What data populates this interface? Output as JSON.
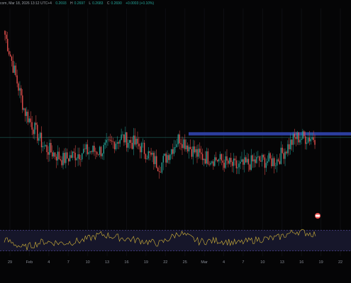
{
  "header": {
    "symbol_suffix": "com, Mar 18, 2026 13:12 UTC+4",
    "ohlc": [
      {
        "label": "",
        "value": "0.2693"
      },
      {
        "label": "H",
        "value": "0.2697"
      },
      {
        "label": "L",
        "value": "0.2683"
      },
      {
        "label": "C",
        "value": "0.2690"
      },
      {
        "label": "",
        "value": "+0.0003 (+0.10%)"
      }
    ]
  },
  "colors": {
    "background": "#050506",
    "up": "#26a69a",
    "down": "#ef5350",
    "zone": "#2c3e9e",
    "rsi_line": "#d7b83a",
    "rsi_band": "#16162a",
    "dashed": "#6a5cc0",
    "price_line": "#1d5f58",
    "indicator_badge": "#ef5350"
  },
  "x_axis": {
    "labels": [
      "29",
      "Feb",
      "4",
      "7",
      "10",
      "13",
      "16",
      "19",
      "22",
      "25",
      "Mar",
      "4",
      "7",
      "10",
      "13",
      "16",
      "19",
      "22"
    ]
  },
  "chart_data": [
    {
      "type": "candlestick",
      "title": "",
      "x": [
        "Jan 29",
        "Feb 1",
        "Feb 4",
        "Feb 7",
        "Feb 10",
        "Feb 13",
        "Feb 16",
        "Feb 19",
        "Feb 22",
        "Feb 25",
        "Mar 1",
        "Mar 4",
        "Mar 7",
        "Mar 10",
        "Mar 13",
        "Mar 16",
        "Mar 18"
      ],
      "series": [
        {
          "values": [
            0.348,
            0.29,
            0.262,
            0.252,
            0.258,
            0.259,
            0.269,
            0.262,
            0.247,
            0.269,
            0.255,
            0.252,
            0.246,
            0.251,
            0.251,
            0.269,
            0.269
          ]
        }
      ],
      "resistance_zone": [
        0.2705,
        0.273
      ],
      "current_price": 0.269,
      "ylim": [
        0.205,
        0.368
      ]
    },
    {
      "type": "line",
      "title": "",
      "x": [
        "Jan 29",
        "Feb 1",
        "Feb 4",
        "Feb 7",
        "Feb 10",
        "Feb 13",
        "Feb 16",
        "Feb 19",
        "Feb 22",
        "Feb 25",
        "Mar 1",
        "Mar 4",
        "Mar 7",
        "Mar 10",
        "Mar 13",
        "Mar 16",
        "Mar 18"
      ],
      "series": [
        {
          "values": [
            52,
            36,
            48,
            45,
            50,
            62,
            55,
            50,
            44,
            65,
            48,
            50,
            45,
            52,
            55,
            68,
            62
          ]
        }
      ],
      "ylim": [
        20,
        80
      ],
      "bands": [
        30,
        70
      ]
    }
  ]
}
